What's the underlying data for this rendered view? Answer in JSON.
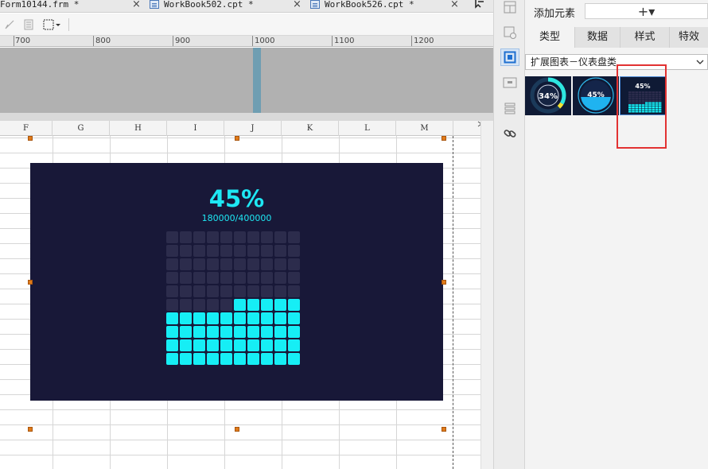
{
  "tabs": [
    {
      "title": "Form10144.frm *"
    },
    {
      "title": "WorkBook502.cpt *"
    },
    {
      "title": "WorkBook526.cpt *"
    }
  ],
  "tab_close_symbol": "×",
  "ruler": {
    "labels": [
      "700",
      "800",
      "900",
      "1000",
      "1100",
      "1200"
    ]
  },
  "columns": [
    "F",
    "G",
    "H",
    "I",
    "J",
    "K",
    "L",
    "M"
  ],
  "chart": {
    "percent_text": "45%",
    "ratio_text": "180000/400000",
    "grid_rows": 10,
    "grid_cols": 10,
    "fill_fraction": 0.45,
    "colors": {
      "background": "#181838",
      "filled": "#16eef5",
      "empty": "#2c2c4c"
    }
  },
  "panel": {
    "add_element_label": "添加元素",
    "add_button_symbol": "+▾",
    "tabs": [
      "类型",
      "数据",
      "样式",
      "特效"
    ],
    "active_tab": "类型",
    "category": "扩展图表－仪表盘类",
    "thumbnails": [
      {
        "label": "34%",
        "kind": "ring-gauge"
      },
      {
        "label": "45%",
        "kind": "liquid-gauge"
      },
      {
        "label": "45%",
        "kind": "block-gauge",
        "selected": true
      }
    ]
  },
  "side_icons": [
    "layout-icon",
    "widget-settings-icon",
    "chart-type-icon",
    "frame-icon",
    "list-icon",
    "link-icon"
  ],
  "accent_colors": {
    "highlight_box": "#e23232",
    "handle": "#e07b1a"
  }
}
